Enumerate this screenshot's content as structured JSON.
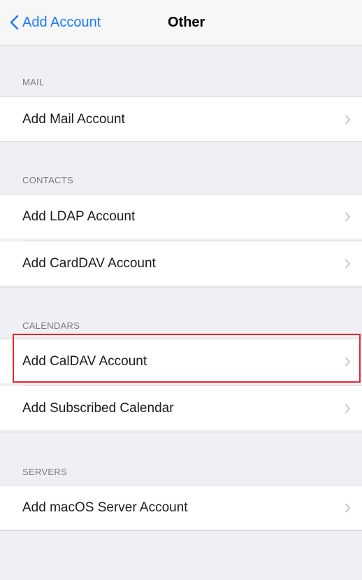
{
  "navbar": {
    "back_label": "Add Account",
    "title": "Other",
    "accent_color": "#1a7cf5"
  },
  "sections": {
    "mail": {
      "header": "MAIL",
      "items": [
        {
          "label": "Add Mail Account"
        }
      ]
    },
    "contacts": {
      "header": "CONTACTS",
      "items": [
        {
          "label": "Add LDAP Account"
        },
        {
          "label": "Add CardDAV Account"
        }
      ]
    },
    "calendars": {
      "header": "CALENDARS",
      "items": [
        {
          "label": "Add CalDAV Account"
        },
        {
          "label": "Add Subscribed Calendar"
        }
      ]
    },
    "servers": {
      "header": "SERVERS",
      "items": [
        {
          "label": "Add macOS Server Account"
        }
      ]
    }
  },
  "icons": {
    "back": "chevron-left-icon",
    "row_disclosure": "chevron-right-icon"
  },
  "highlight": {
    "target": "Add CalDAV Account",
    "color": "#e1262c"
  }
}
